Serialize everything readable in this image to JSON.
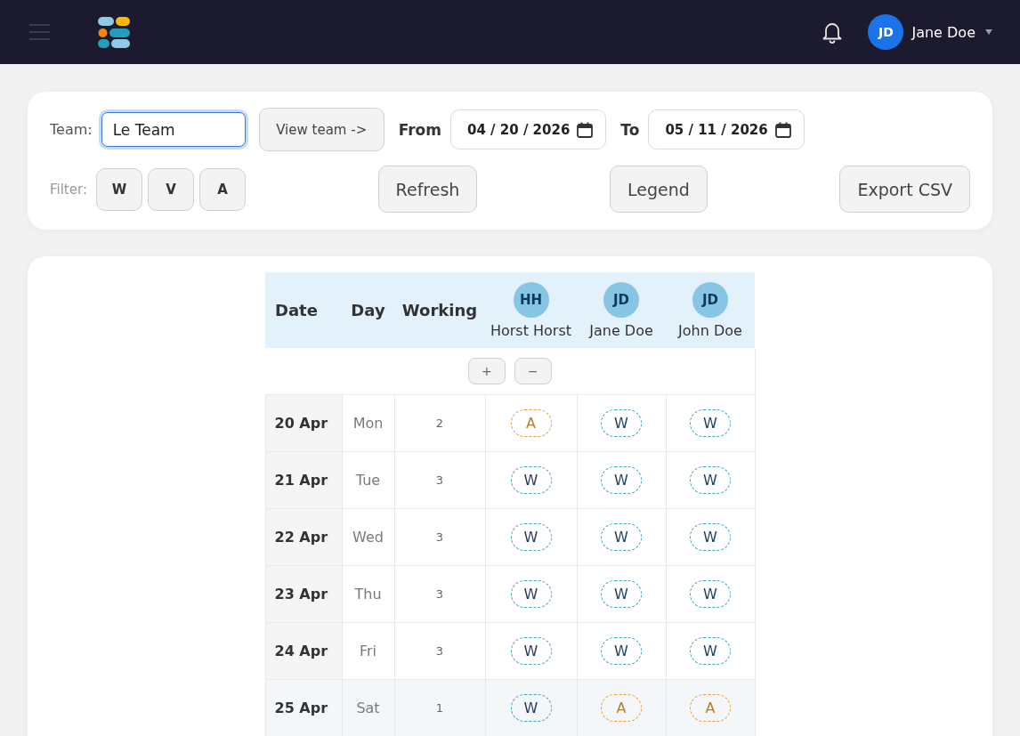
{
  "header": {
    "user": {
      "initials": "JD",
      "name": "Jane Doe"
    }
  },
  "toolbar": {
    "team_label": "Team:",
    "team_value": "Le Team",
    "view_team_button": "View team ->",
    "from_label": "From",
    "from_date": "04 / 20 / 2026",
    "to_label": "To",
    "to_date": "05 / 11 / 2026",
    "filter_label": "Filter:",
    "filters": [
      "W",
      "V",
      "A"
    ],
    "refresh_button": "Refresh",
    "legend_button": "Legend",
    "export_button": "Export CSV"
  },
  "table": {
    "columns": [
      "Date",
      "Day",
      "Working"
    ],
    "members": [
      {
        "initials": "HH",
        "name": "Horst Horst"
      },
      {
        "initials": "JD",
        "name": "Jane Doe"
      },
      {
        "initials": "JD",
        "name": "John Doe"
      }
    ],
    "zoom_buttons": [
      "+",
      "−"
    ],
    "rows": [
      {
        "date": "20 Apr",
        "day": "Mon",
        "working": "2",
        "highlighted": false,
        "cells": [
          {
            "label": "A",
            "kind": "absent"
          },
          {
            "label": "W",
            "kind": "working"
          },
          {
            "label": "W",
            "kind": "working"
          }
        ]
      },
      {
        "date": "21 Apr",
        "day": "Tue",
        "working": "3",
        "highlighted": false,
        "cells": [
          {
            "label": "W",
            "kind": "working"
          },
          {
            "label": "W",
            "kind": "working"
          },
          {
            "label": "W",
            "kind": "working"
          }
        ]
      },
      {
        "date": "22 Apr",
        "day": "Wed",
        "working": "3",
        "highlighted": false,
        "cells": [
          {
            "label": "W",
            "kind": "working"
          },
          {
            "label": "W",
            "kind": "working"
          },
          {
            "label": "W",
            "kind": "working"
          }
        ]
      },
      {
        "date": "23 Apr",
        "day": "Thu",
        "working": "3",
        "highlighted": false,
        "cells": [
          {
            "label": "W",
            "kind": "working"
          },
          {
            "label": "W",
            "kind": "working"
          },
          {
            "label": "W",
            "kind": "working"
          }
        ]
      },
      {
        "date": "24 Apr",
        "day": "Fri",
        "working": "3",
        "highlighted": false,
        "cells": [
          {
            "label": "W",
            "kind": "working"
          },
          {
            "label": "W",
            "kind": "working"
          },
          {
            "label": "W",
            "kind": "working"
          }
        ]
      },
      {
        "date": "25 Apr",
        "day": "Sat",
        "working": "1",
        "highlighted": true,
        "cells": [
          {
            "label": "W",
            "kind": "working"
          },
          {
            "label": "A",
            "kind": "absent"
          },
          {
            "label": "A",
            "kind": "absent"
          }
        ]
      }
    ]
  }
}
